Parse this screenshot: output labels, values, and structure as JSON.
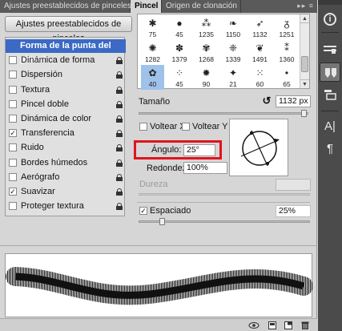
{
  "tabs": [
    {
      "label": "Ajustes preestablecidos de pinceles",
      "active": false
    },
    {
      "label": "Pincel",
      "active": true
    },
    {
      "label": "Origen de clonación",
      "active": false
    }
  ],
  "tabs_menu_icon": "panel-menu-icon",
  "preset_button": "Ajustes preestablecidos de pinceles",
  "brush_options": [
    {
      "label": "Forma de la punta del pincel",
      "checkbox": false,
      "checked": false,
      "locked": false,
      "selected": true
    },
    {
      "label": "Dinámica de forma",
      "checkbox": true,
      "checked": false,
      "locked": true,
      "selected": false
    },
    {
      "label": "Dispersión",
      "checkbox": true,
      "checked": false,
      "locked": true,
      "selected": false
    },
    {
      "label": "Textura",
      "checkbox": true,
      "checked": false,
      "locked": true,
      "selected": false
    },
    {
      "label": "Pincel doble",
      "checkbox": true,
      "checked": false,
      "locked": true,
      "selected": false
    },
    {
      "label": "Dinámica de color",
      "checkbox": true,
      "checked": false,
      "locked": true,
      "selected": false
    },
    {
      "label": "Transferencia",
      "checkbox": true,
      "checked": true,
      "locked": true,
      "selected": false
    },
    {
      "label": "Ruido",
      "checkbox": true,
      "checked": false,
      "locked": true,
      "selected": false
    },
    {
      "label": "Bordes húmedos",
      "checkbox": true,
      "checked": false,
      "locked": true,
      "selected": false
    },
    {
      "label": "Aerógrafo",
      "checkbox": true,
      "checked": false,
      "locked": true,
      "selected": false
    },
    {
      "label": "Suavizar",
      "checkbox": true,
      "checked": true,
      "locked": true,
      "selected": false
    },
    {
      "label": "Proteger textura",
      "checkbox": true,
      "checked": false,
      "locked": true,
      "selected": false
    }
  ],
  "brush_presets": [
    {
      "size": "75",
      "glyph": "✱",
      "selected": false
    },
    {
      "size": "45",
      "glyph": "●",
      "selected": false
    },
    {
      "size": "1235",
      "glyph": "⁂",
      "selected": false
    },
    {
      "size": "1150",
      "glyph": "❧",
      "selected": false
    },
    {
      "size": "1132",
      "glyph": "➶",
      "selected": false
    },
    {
      "size": "1251",
      "glyph": "ᵹ",
      "selected": false
    },
    {
      "size": "1282",
      "glyph": "✺",
      "selected": false
    },
    {
      "size": "1379",
      "glyph": "✽",
      "selected": false
    },
    {
      "size": "1268",
      "glyph": "✾",
      "selected": false
    },
    {
      "size": "1339",
      "glyph": "❈",
      "selected": false
    },
    {
      "size": "1491",
      "glyph": "❦",
      "selected": false
    },
    {
      "size": "1360",
      "glyph": "⁑",
      "selected": false
    },
    {
      "size": "40",
      "glyph": "✿",
      "selected": true
    },
    {
      "size": "45",
      "glyph": "⁘",
      "selected": false
    },
    {
      "size": "90",
      "glyph": "✹",
      "selected": false
    },
    {
      "size": "21",
      "glyph": "✦",
      "selected": false
    },
    {
      "size": "60",
      "glyph": "⁙",
      "selected": false
    },
    {
      "size": "65",
      "glyph": "•",
      "selected": false
    }
  ],
  "size": {
    "label": "Tamaño",
    "value": "1132 px",
    "reset_icon": "reset-circle-arrow-icon",
    "level": 0.97
  },
  "flip_x": {
    "label": "Voltear X",
    "checked": false
  },
  "flip_y": {
    "label": "Voltear Y",
    "checked": false
  },
  "angle": {
    "label": "Ángulo:",
    "value": "25°"
  },
  "roundness": {
    "label": "Redondez:",
    "value": "100%"
  },
  "hardness": {
    "label": "Dureza",
    "enabled": false
  },
  "spacing": {
    "label": "Espaciado",
    "checked": true,
    "value": "25%",
    "level": 0.25
  },
  "footer_icons": [
    "eye-toggle-icon",
    "new-preset-icon",
    "new-layer-icon",
    "trash-icon"
  ],
  "dock_icons": [
    "info-icon",
    "brush-presets-icon",
    "brush-icon",
    "clone-source-icon",
    "character-icon",
    "paragraph-icon"
  ],
  "dock_labels": {
    "character": "A|",
    "paragraph": "¶",
    "info": "i"
  },
  "colors": {
    "selection": "#3b69c4",
    "highlight": "#e0141e",
    "dock": "#4b4b4b",
    "panel": "#d6d6d6"
  }
}
